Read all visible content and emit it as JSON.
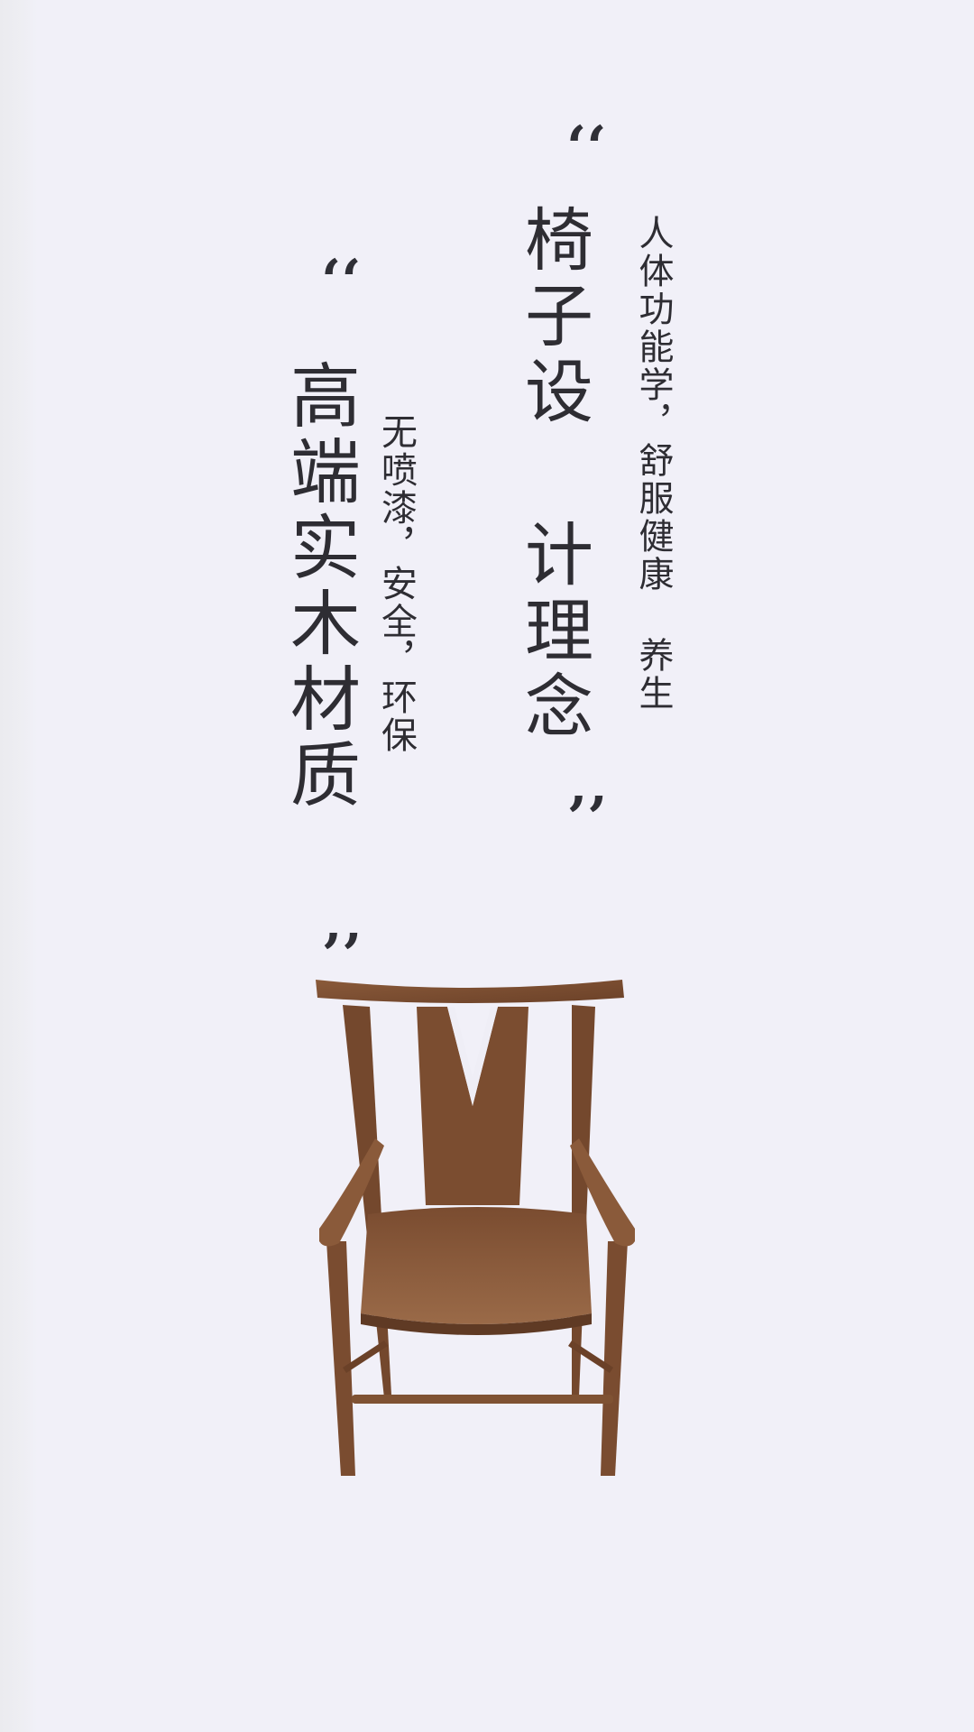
{
  "block1": {
    "title": "椅子设 计理念",
    "subtitle": "人体功能学，舒服健康 养生"
  },
  "block2": {
    "title": "高端实木材质",
    "subtitle": "无喷漆，安全，环保"
  },
  "quote_mark": "‘‘",
  "colors": {
    "background": "#f1f0f8",
    "text": "#2e2d33",
    "wood_dark": "#6b4128",
    "wood_mid": "#7f5233",
    "wood_light": "#9b6a48"
  },
  "image": {
    "icon": "wooden-armchair-image"
  }
}
